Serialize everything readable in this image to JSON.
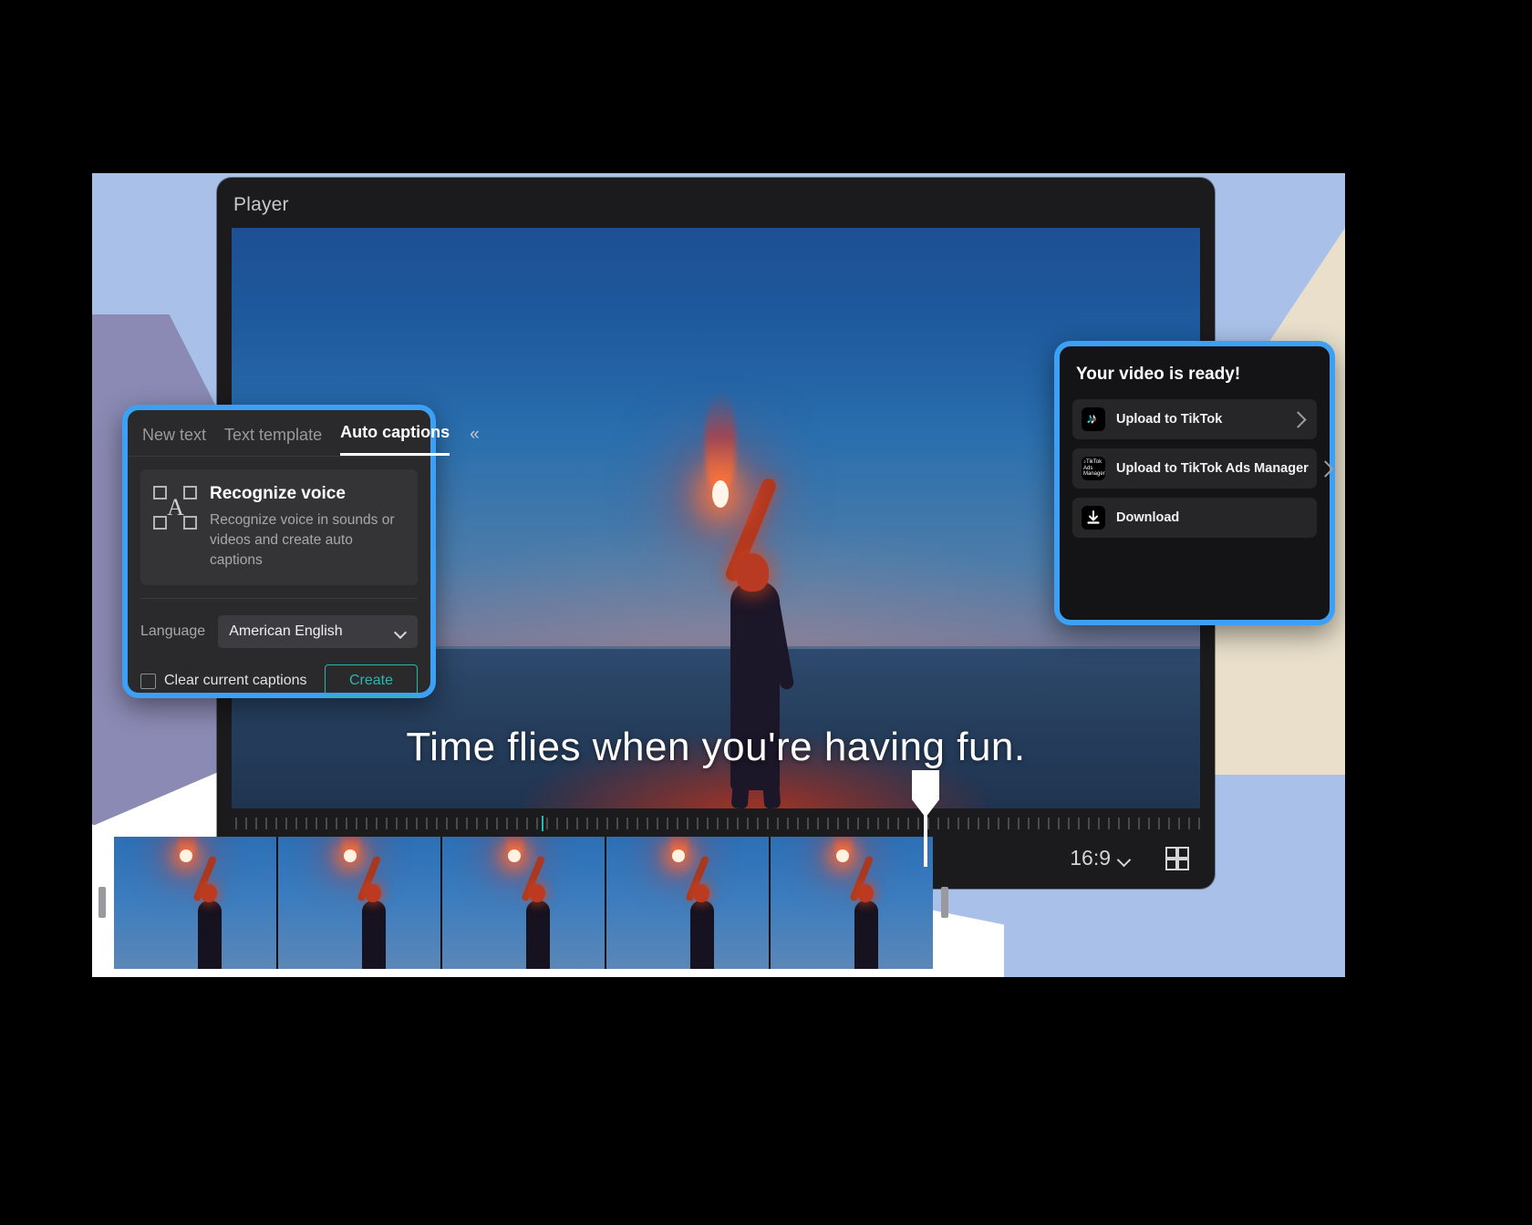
{
  "colors": {
    "accent_blue": "#3da0f5",
    "accent_teal": "#2bb6b0",
    "panel_dark": "#2a2a2c",
    "export_dark": "#141416",
    "canvas_blue": "#a9c1e8",
    "canvas_purple": "#8b8ab4",
    "canvas_cream": "#e9dfcb"
  },
  "editor": {
    "player_label": "Player",
    "caption_text": "Time flies when you're having fun.",
    "controls": {
      "aspect_ratio": "16:9",
      "aspect_ratio_chevron": "chevron-down-icon",
      "fullscreen": "fullscreen-icon"
    }
  },
  "captions_panel": {
    "tabs": [
      {
        "label": "New text",
        "active": false
      },
      {
        "label": "Text template",
        "active": false
      },
      {
        "label": "Auto captions",
        "active": true
      }
    ],
    "collapse_icon": "«",
    "card": {
      "icon": "recognize-voice-icon",
      "icon_glyph": "A",
      "title": "Recognize voice",
      "description": "Recognize voice in sounds or videos and create auto captions"
    },
    "language_label": "Language",
    "language_value": "American English",
    "clear_captions_label": "Clear current captions",
    "clear_captions_checked": false,
    "create_label": "Create"
  },
  "export_panel": {
    "title": "Your video is ready!",
    "rows": [
      {
        "label": "Upload to TikTok",
        "icon": "tiktok-icon",
        "chevron": true
      },
      {
        "label": "Upload to TikTok Ads Manager",
        "icon": "tiktok-ads-manager-icon",
        "chevron": true
      },
      {
        "label": "Download",
        "icon": "download-icon",
        "chevron": false
      }
    ]
  },
  "timeline": {
    "handle_left": "trim-handle-left",
    "handle_right": "trim-handle-right",
    "playhead": "playhead",
    "frame_count": 5
  }
}
